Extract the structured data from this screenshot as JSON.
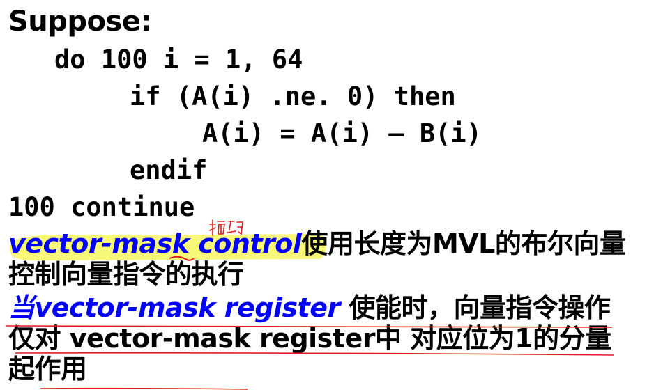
{
  "heading": "Suppose:",
  "code": {
    "line1": "do 100 i = 1, 64",
    "line2": "if (A(i) .ne. 0) then",
    "line3": "A(i) = A(i) – B(i)",
    "line4": "endif",
    "line5": "100 continue"
  },
  "para1": {
    "term": "vector-mask control",
    "text": "使用长度为MVL的布尔向量控制向量指令的执行"
  },
  "para2": {
    "term_prefix": "当",
    "term": "vector-mask register",
    "text": " 使能时，向量指令操作仅对 vector-mask register中 对应位为1的分量起作用"
  },
  "annotation": {
    "handwritten_note": "掩码",
    "highlight_color": "#f7f760",
    "ink_color": "#e02020"
  }
}
